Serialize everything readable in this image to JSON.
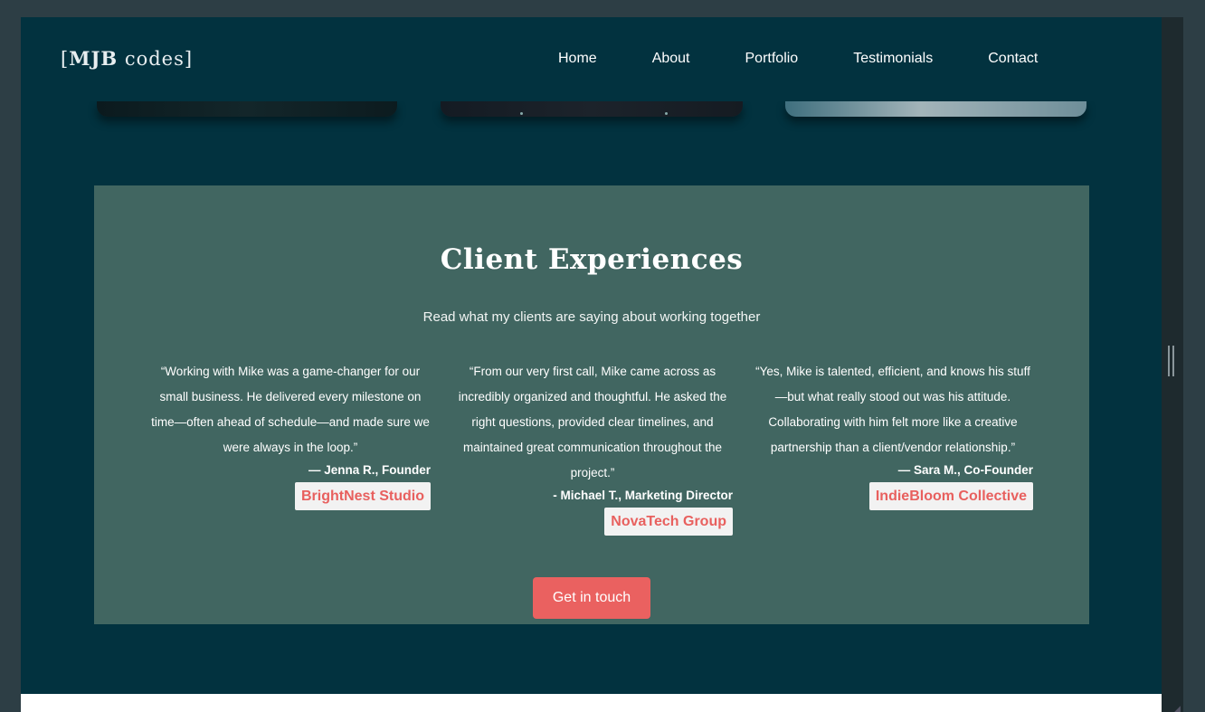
{
  "nav": {
    "logo_bold": "MJB",
    "logo_rest": " codes]",
    "logo_open": "[",
    "links": [
      "Home",
      "About",
      "Portfolio",
      "Testimonials",
      "Contact"
    ]
  },
  "testimonials": {
    "title": "Client Experiences",
    "subtitle": "Read what my clients are saying about working together",
    "items": [
      {
        "quote": "“Working with Mike was a game-changer for our small business. He delivered every milestone on time—often ahead of schedule—and made sure we were always in the loop.”",
        "author": "— Jenna R., Founder",
        "company": "BrightNest Studio"
      },
      {
        "quote": "“From our very first call, Mike came across as incredibly organized and thoughtful. He asked the right questions, provided clear timelines, and maintained great communication throughout the project.”",
        "author": "- Michael T., Marketing Director",
        "company": "NovaTech Group"
      },
      {
        "quote": "“Yes, Mike is talented, efficient, and knows his stuff—but what really stood out was his attitude. Collaborating with him felt more like a creative partnership than a client/vendor relationship.”",
        "author": "— Sara M., Co-Founder",
        "company": "IndieBloom Collective"
      }
    ],
    "cta_label": "Get in touch"
  },
  "colors": {
    "page_bg": "#02323f",
    "section_bg": "#416661",
    "accent": "#ea6160"
  }
}
